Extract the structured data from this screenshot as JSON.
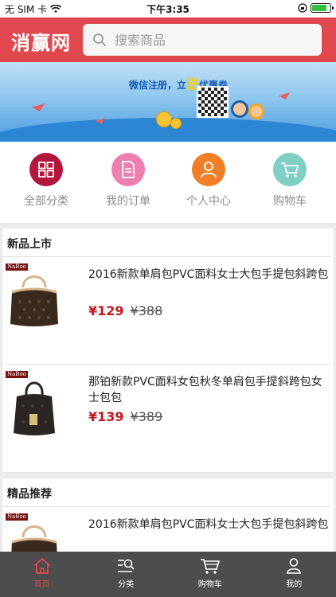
{
  "status_bar": {
    "carrier": "无 SIM 卡",
    "time": "下午3:35",
    "battery_level": 0.85
  },
  "header": {
    "logo": "消赢网",
    "search_placeholder": "搜索商品",
    "search_icon": "search-icon"
  },
  "banner": {
    "text_prefix": "微信注册，立",
    "text_highlight": "送",
    "text_suffix": "优惠券"
  },
  "nav": [
    {
      "label": "全部分类",
      "icon": "grid-icon",
      "color": "#b3163d"
    },
    {
      "label": "我的订单",
      "icon": "document-icon",
      "color": "#ef7fb0"
    },
    {
      "label": "个人中心",
      "icon": "person-icon",
      "color": "#f07f27"
    },
    {
      "label": "购物车",
      "icon": "cart-icon",
      "color": "#7fcfc4"
    }
  ],
  "sections": [
    {
      "title": "新品上市",
      "products": [
        {
          "brand": "NaBoo",
          "title": "2016新款单肩包PVC面料女士大包手提包斜跨包",
          "price": "¥129",
          "old_price": "¥388"
        },
        {
          "brand": "NaBoo",
          "title": "那铂新款PVC面料女包秋冬单肩包手提斜跨包女士包包",
          "price": "¥139",
          "old_price": "¥389"
        }
      ]
    },
    {
      "title": "精品推荐",
      "products": [
        {
          "brand": "NaBoo",
          "title": "2016新款单肩包PVC面料女士大包手提包斜跨包"
        }
      ]
    }
  ],
  "tabbar": [
    {
      "label": "首页",
      "icon": "home-icon",
      "active": true
    },
    {
      "label": "分类",
      "icon": "category-search-icon",
      "active": false
    },
    {
      "label": "购物车",
      "icon": "cart-icon",
      "active": false
    },
    {
      "label": "我的",
      "icon": "user-icon",
      "active": false
    }
  ],
  "colors": {
    "brand_red": "#e1474e",
    "price_red": "#c8161d",
    "tabbar_bg": "#4d4d4d"
  }
}
